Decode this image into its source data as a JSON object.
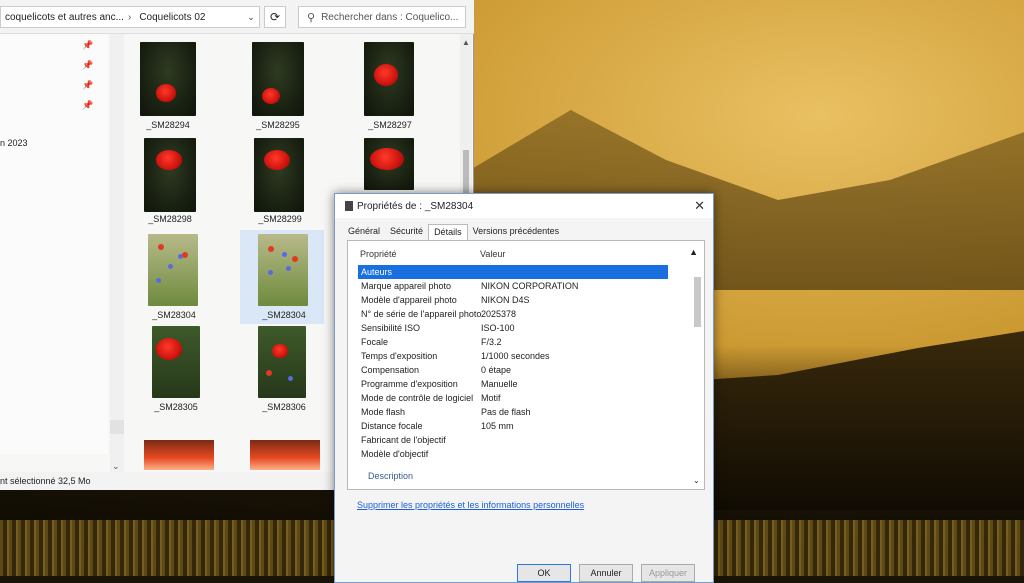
{
  "explorer": {
    "breadcrumb": [
      "coquelicots et autres anc...",
      "Coquelicots 02"
    ],
    "search_placeholder": "Rechercher dans : Coquelico...",
    "nav_label": "n 2023",
    "status_text": "nt sélectionné 32,5 Mo",
    "thumbnails": [
      {
        "label": "_SM28294",
        "kind": "dark"
      },
      {
        "label": "_SM28295",
        "kind": "dark"
      },
      {
        "label": "_SM28297",
        "kind": "dark"
      },
      {
        "label": "_SM28298",
        "kind": "dark"
      },
      {
        "label": "_SM28299",
        "kind": "dark"
      },
      {
        "label": "_SM28304",
        "kind": "field"
      },
      {
        "label": "_SM28304",
        "kind": "field",
        "selected": true
      },
      {
        "label": "_SM28305",
        "kind": "dark2"
      },
      {
        "label": "_SM28306",
        "kind": "dark2"
      }
    ]
  },
  "dialog": {
    "title": "Propriétés de : _SM28304",
    "tabs": [
      "Général",
      "Sécurité",
      "Détails",
      "Versions précédentes"
    ],
    "active_tab": "Détails",
    "col_property": "Propriété",
    "col_value": "Valeur",
    "rows": [
      {
        "p": "Auteurs",
        "v": "",
        "selected": true
      },
      {
        "p": "Marque appareil photo",
        "v": "NIKON CORPORATION"
      },
      {
        "p": "Modèle d'appareil photo",
        "v": "NIKON D4S"
      },
      {
        "p": "N° de série de l'appareil photo",
        "v": "2025378"
      },
      {
        "p": "Sensibilité ISO",
        "v": "ISO-100"
      },
      {
        "p": "Focale",
        "v": "F/3.2"
      },
      {
        "p": "Temps d'exposition",
        "v": "1/1000 secondes"
      },
      {
        "p": "Compensation",
        "v": "0 étape"
      },
      {
        "p": "Programme d'exposition",
        "v": "Manuelle"
      },
      {
        "p": "Mode de contrôle de logiciel",
        "v": "Motif"
      },
      {
        "p": "Mode flash",
        "v": "Pas de flash"
      },
      {
        "p": "Distance focale",
        "v": "105 mm"
      },
      {
        "p": "Fabricant de l'objectif",
        "v": ""
      },
      {
        "p": "Modèle d'objectif",
        "v": ""
      }
    ],
    "section_description": "Description",
    "remove_link": "Supprimer les propriétés et les informations personnelles",
    "buttons": {
      "ok": "OK",
      "cancel": "Annuler",
      "apply": "Appliquer"
    }
  }
}
